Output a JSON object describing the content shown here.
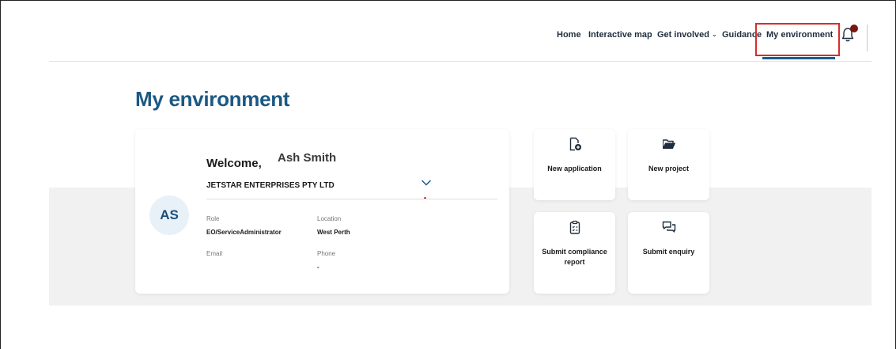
{
  "nav": {
    "home": "Home",
    "interactive_map": "Interactive map",
    "get_involved": "Get involved",
    "guidance": "Guidance",
    "my_environment": "My environment",
    "caret": "⌄"
  },
  "page": {
    "title": "My environment"
  },
  "profile": {
    "avatar_initials": "AS",
    "welcome": "Welcome,",
    "name": "Ash Smith",
    "organisation": "JETSTAR ENTERPRISES PTY LTD",
    "role_label": "Role",
    "role_value": "EO/ServiceAdministrator",
    "location_label": "Location",
    "location_value": "West Perth",
    "email_label": "Email",
    "phone_label": "Phone",
    "phone_value": "-"
  },
  "actions": {
    "new_application": "New application",
    "new_project": "New project",
    "submit_compliance_report": "Submit compliance report",
    "submit_enquiry": "Submit enquiry"
  },
  "colors": {
    "brand_blue": "#1b5883",
    "active_underline": "#1c5b8c",
    "highlight": "#d62d2d",
    "notification_dot": "#7a1513"
  },
  "icons": [
    "bell-icon",
    "chevron-down-icon",
    "new-file-icon",
    "folder-open-icon",
    "clipboard-checklist-icon",
    "chat-bubbles-icon"
  ]
}
